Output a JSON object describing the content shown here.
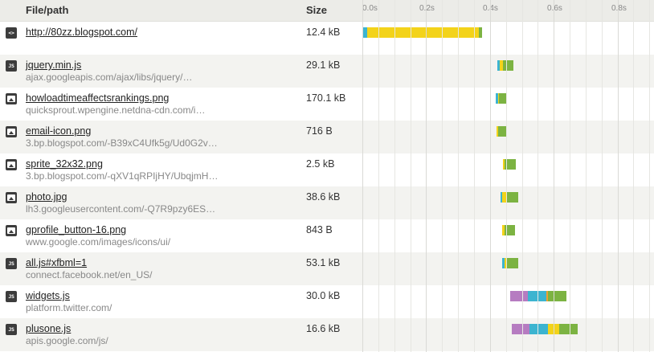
{
  "header": {
    "file_col": "File/path",
    "size_col": "Size",
    "ticks": [
      "0.0s",
      "0.2s",
      "0.4s",
      "0.6s",
      "0.8s"
    ]
  },
  "rows": [
    {
      "name": "http://80zz.blogspot.com/",
      "host": "",
      "size": "12.4 kB",
      "type": "html",
      "icon": "html-file-icon",
      "timing": {
        "start": 0.0,
        "blocked": 0.0,
        "dns": 0.015,
        "connect": 0.0,
        "wait": 0.35,
        "receive": 0.01
      }
    },
    {
      "name": "jquery.min.js",
      "host": "ajax.googleapis.com/ajax/libs/jquery/…",
      "size": "29.1 kB",
      "type": "js",
      "icon": "javascript-file-icon",
      "timing": {
        "start": 0.423,
        "blocked": 0.0,
        "dns": 0.007,
        "connect": 0.0,
        "wait": 0.01,
        "receive": 0.033
      }
    },
    {
      "name": "howloadtimeaffectsrankings.png",
      "host": "quicksprout.wpengine.netdna-cdn.com/i…",
      "size": "170.1 kB",
      "type": "img",
      "icon": "image-file-icon",
      "timing": {
        "start": 0.418,
        "blocked": 0.0,
        "dns": 0.007,
        "connect": 0.0,
        "wait": 0.003,
        "receive": 0.025
      }
    },
    {
      "name": "email-icon.png",
      "host": "3.bp.blogspot.com/-B39xC4Ufk5g/Ud0G2v…",
      "size": "716 B",
      "type": "img",
      "icon": "image-file-icon",
      "timing": {
        "start": 0.42,
        "blocked": 0.0,
        "dns": 0.0,
        "connect": 0.0,
        "wait": 0.005,
        "receive": 0.028
      }
    },
    {
      "name": "sprite_32x32.png",
      "host": "3.bp.blogspot.com/-qXV1qRPIjHY/UbqjmH…",
      "size": "2.5 kB",
      "type": "img",
      "icon": "image-file-icon",
      "timing": {
        "start": 0.44,
        "blocked": 0.0,
        "dns": 0.0,
        "connect": 0.0,
        "wait": 0.005,
        "receive": 0.035
      }
    },
    {
      "name": "photo.jpg",
      "host": "lh3.googleusercontent.com/-Q7R9pzy6ES…",
      "size": "38.6 kB",
      "type": "img",
      "icon": "image-file-icon",
      "timing": {
        "start": 0.433,
        "blocked": 0.0,
        "dns": 0.005,
        "connect": 0.0,
        "wait": 0.012,
        "receive": 0.038
      }
    },
    {
      "name": "gprofile_button-16.png",
      "host": "www.google.com/images/icons/ui/",
      "size": "843 B",
      "type": "img",
      "icon": "image-file-icon",
      "timing": {
        "start": 0.438,
        "blocked": 0.0,
        "dns": 0.0,
        "connect": 0.0,
        "wait": 0.008,
        "receive": 0.033
      }
    },
    {
      "name": "all.js#xfbml=1",
      "host": "connect.facebook.net/en_US/",
      "size": "53.1 kB",
      "type": "js",
      "icon": "javascript-file-icon",
      "timing": {
        "start": 0.438,
        "blocked": 0.0,
        "dns": 0.008,
        "connect": 0.0,
        "wait": 0.005,
        "receive": 0.038
      }
    },
    {
      "name": "widgets.js",
      "host": "platform.twitter.com/",
      "size": "30.0 kB",
      "type": "js",
      "icon": "javascript-file-icon",
      "timing": {
        "start": 0.463,
        "blocked": 0.055,
        "dns": 0.06,
        "connect": 0.003,
        "wait": 0.0,
        "receive": 0.06
      }
    },
    {
      "name": "plusone.js",
      "host": "apis.google.com/js/",
      "size": "16.6 kB",
      "type": "js",
      "icon": "javascript-file-icon",
      "timing": {
        "start": 0.468,
        "blocked": 0.055,
        "dns": 0.06,
        "connect": 0.0,
        "wait": 0.033,
        "receive": 0.06
      }
    }
  ],
  "colors": {
    "blocked": "#b67cc1",
    "dns": "#3cb4d0",
    "wait": "#f3d31a",
    "receive": "#7cb342",
    "connect": "#f0a030"
  }
}
